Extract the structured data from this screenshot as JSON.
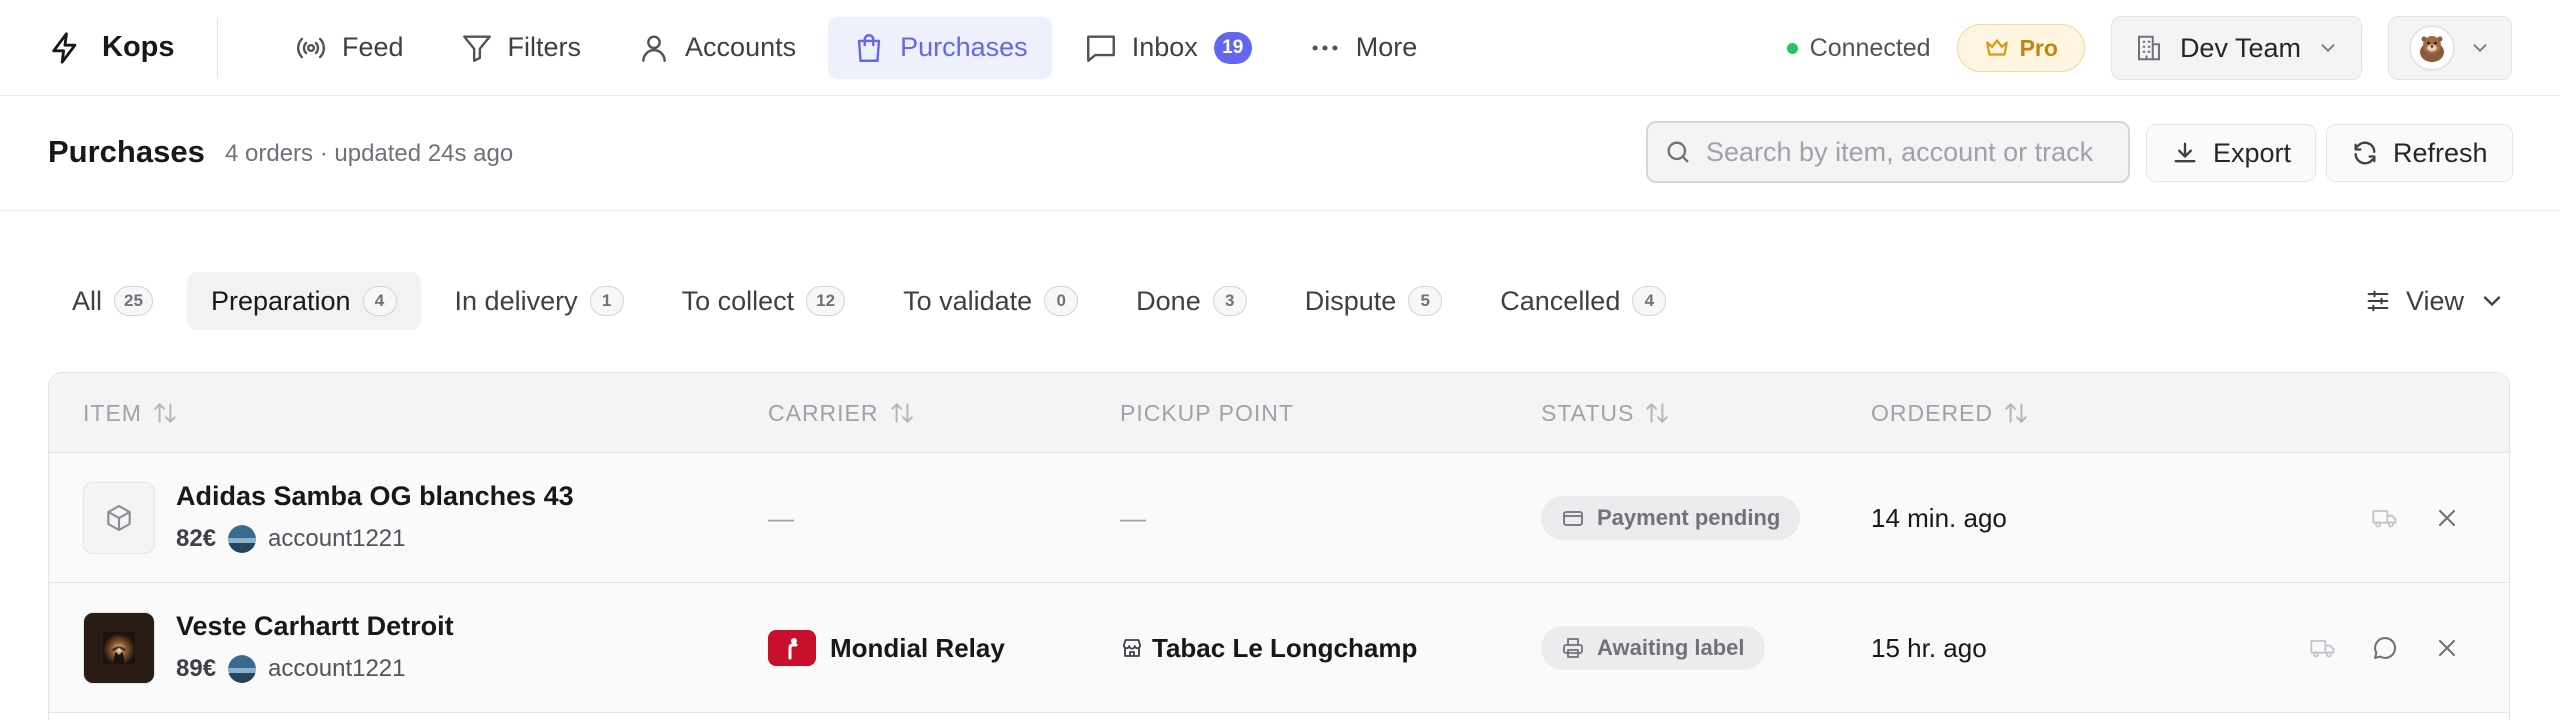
{
  "app": {
    "name": "Kops"
  },
  "nav": {
    "items": [
      {
        "label": "Feed",
        "icon": "broadcast-icon"
      },
      {
        "label": "Filters",
        "icon": "filter-icon"
      },
      {
        "label": "Accounts",
        "icon": "user-icon"
      },
      {
        "label": "Purchases",
        "icon": "shopping-bag-icon",
        "active": true
      },
      {
        "label": "Inbox",
        "icon": "message-icon",
        "badge": "19"
      },
      {
        "label": "More",
        "icon": "more-icon"
      }
    ]
  },
  "topbar": {
    "status": "Connected",
    "plan": "Pro",
    "team": "Dev Team",
    "avatar_icon": "otter-avatar"
  },
  "page": {
    "title": "Purchases",
    "subtitle": "4 orders · updated 24s ago",
    "search_placeholder": "Search by item, account or track",
    "export_label": "Export",
    "refresh_label": "Refresh"
  },
  "tabs": [
    {
      "label": "All",
      "count": "25"
    },
    {
      "label": "Preparation",
      "count": "4",
      "active": true
    },
    {
      "label": "In delivery",
      "count": "1"
    },
    {
      "label": "To collect",
      "count": "12"
    },
    {
      "label": "To validate",
      "count": "0"
    },
    {
      "label": "Done",
      "count": "3"
    },
    {
      "label": "Dispute",
      "count": "5"
    },
    {
      "label": "Cancelled",
      "count": "4"
    }
  ],
  "view_label": "View",
  "table": {
    "columns": {
      "item": "ITEM",
      "carrier": "CARRIER",
      "pickup": "PICKUP POINT",
      "status": "STATUS",
      "ordered": "ORDERED"
    },
    "rows": [
      {
        "title": "Adidas Samba OG blanches 43",
        "price": "82€",
        "account": "account1221",
        "carrier": "—",
        "pickup": "—",
        "status": "Payment pending",
        "status_icon": "credit-card-icon",
        "ordered": "14 min. ago",
        "thumbnail": "package-icon"
      },
      {
        "title": "Veste Carhartt Detroit",
        "price": "89€",
        "account": "account1221",
        "carrier": "Mondial Relay",
        "pickup": "Tabac Le Longchamp",
        "status": "Awaiting label",
        "status_icon": "printer-icon",
        "ordered": "15 hr. ago",
        "thumbnail": "jacket-photo"
      }
    ]
  },
  "colors": {
    "accent": "#6366f1",
    "connected": "#22c55e",
    "pro": "#c2840a",
    "mondial_relay": "#c8102e"
  }
}
